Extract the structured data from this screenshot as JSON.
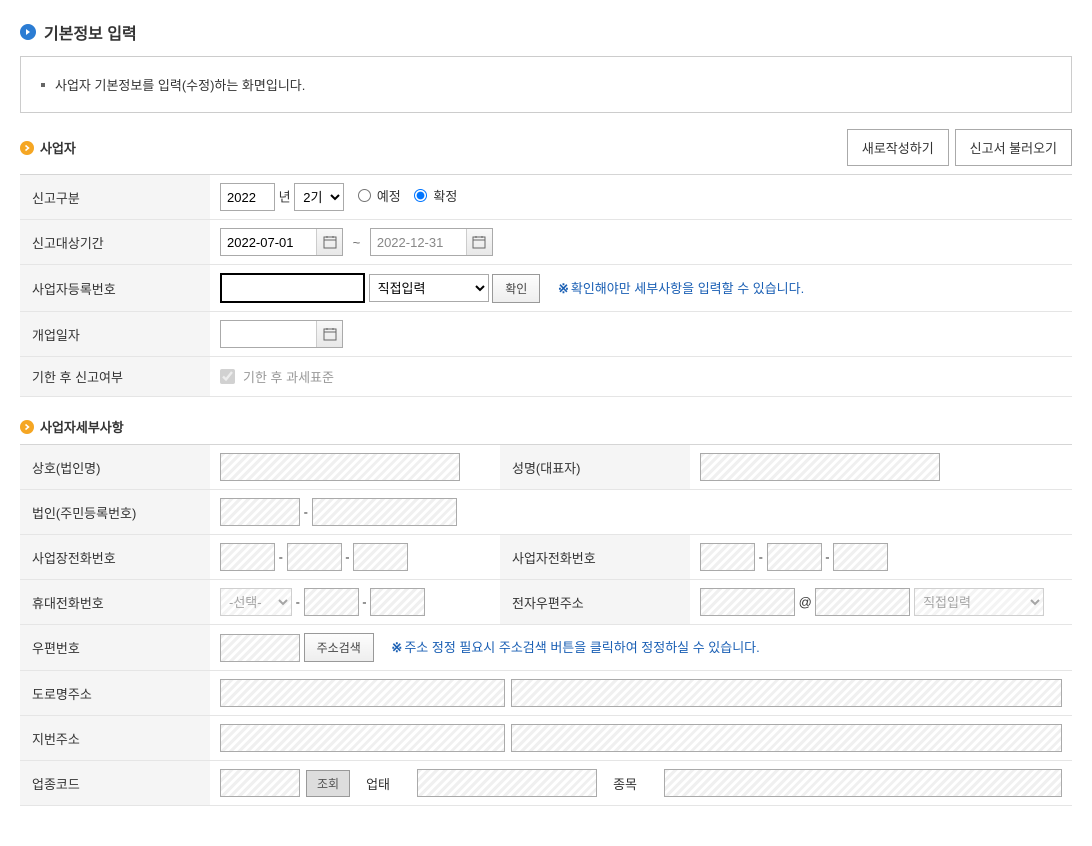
{
  "page": {
    "title": "기본정보 입력",
    "infoText": "사업자 기본정보를 입력(수정)하는 화면입니다."
  },
  "business": {
    "sectionTitle": "사업자",
    "btnNew": "새로작성하기",
    "btnLoad": "신고서 불러오기",
    "labels": {
      "reportType": "신고구분",
      "year": "2022",
      "yearSuffix": "년",
      "period": "2기",
      "scheduled": "예정",
      "confirmed": "확정",
      "reportPeriod": "신고대상기간",
      "dateFrom": "2022-07-01",
      "dateTo": "2022-12-31",
      "dateSep": "~",
      "bizRegNo": "사업자등록번호",
      "directInput": "직접입력",
      "confirmBtn": "확인",
      "confirmHint": "확인해야만 세부사항을 입력할 수 있습니다.",
      "openDate": "개업일자",
      "lateReport": "기한 후 신고여부",
      "lateCheckbox": "기한 후 과세표준"
    }
  },
  "detail": {
    "sectionTitle": "사업자세부사항",
    "labels": {
      "corpName": "상호(법인명)",
      "repName": "성명(대표자)",
      "corpRegNo": "법인(주민등록번호)",
      "bizPhone": "사업장전화번호",
      "ownerPhone": "사업자전화번호",
      "mobile": "휴대전화번호",
      "mobileSelect": "-선택-",
      "email": "전자우편주소",
      "emailAt": "@",
      "emailSelect": "직접입력",
      "zip": "우편번호",
      "zipSearch": "주소검색",
      "zipHint": "주소 정정 필요시 주소검색 버튼을 클릭하여 정정하실 수 있습니다.",
      "roadAddr": "도로명주소",
      "jibunAddr": "지번주소",
      "bizCode": "업종코드",
      "lookup": "조회",
      "bizKind": "업태",
      "bizItem": "종목",
      "dash": "-"
    }
  },
  "common": {
    "asterisk": "※"
  }
}
